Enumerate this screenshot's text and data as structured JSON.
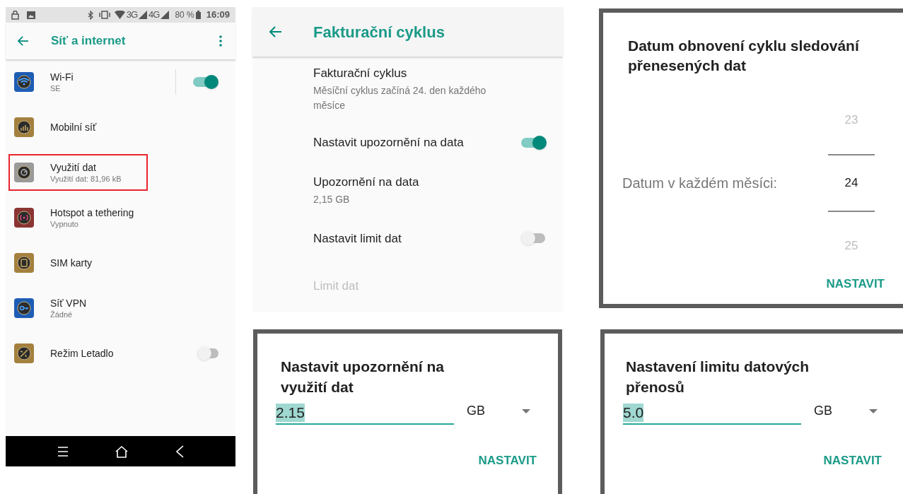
{
  "network_screen": {
    "status_bar": {
      "network_3g": "3G",
      "network_4g": "4G",
      "battery": "80 %",
      "time": "16:09"
    },
    "title": "Síť a internet",
    "items": [
      {
        "label": "Wi-Fi",
        "sublabel": "SE",
        "kind": "switch",
        "on": true,
        "highlighted": false
      },
      {
        "label": "Mobilní síť",
        "kind": "plain",
        "highlighted": false
      },
      {
        "label": "Využití dat",
        "sublabel": "Využití dat: 81,96 kB",
        "kind": "plain",
        "highlighted": true
      },
      {
        "label": "Hotspot a tethering",
        "sublabel": "Vypnuto",
        "kind": "plain",
        "highlighted": false
      },
      {
        "label": "SIM karty",
        "kind": "plain",
        "highlighted": false
      },
      {
        "label": "Síť VPN",
        "sublabel": "Žádné",
        "kind": "plain",
        "highlighted": false
      },
      {
        "label": "Režim Letadlo",
        "kind": "switch",
        "on": false,
        "highlighted": false
      }
    ]
  },
  "billing_screen": {
    "title": "Fakturační cyklus",
    "items": [
      {
        "kind": "text",
        "title": "Fakturační cyklus",
        "summary": "Měsíční cyklus začíná 24. den každého měsíce",
        "disabled": false
      },
      {
        "kind": "switch",
        "title": "Nastavit upozornění na data",
        "on": true
      },
      {
        "kind": "text",
        "title": "Upozornění na data",
        "summary": "2,15 GB",
        "disabled": false
      },
      {
        "kind": "switch",
        "title": "Nastavit limit dat",
        "on": false
      },
      {
        "kind": "text",
        "title": "Limit dat",
        "disabled": true
      }
    ]
  },
  "cycle_dialog": {
    "title": "Datum obnovení cyklu sledování přenesených dat",
    "label": "Datum v každém měsíci:",
    "picker": [
      {
        "value": "23",
        "selected": false
      },
      {
        "value": "24",
        "selected": true
      },
      {
        "value": "25",
        "selected": false
      }
    ],
    "button": "NASTAVIT"
  },
  "warning_dialog": {
    "title": "Nastavit upozornění na využití dat",
    "value": "2.15",
    "unit": "GB",
    "button": "NASTAVIT"
  },
  "limit_dialog": {
    "title": "Nastavení limitu datových přenosů",
    "value": "5.0",
    "unit": "GB",
    "button": "NASTAVIT"
  }
}
